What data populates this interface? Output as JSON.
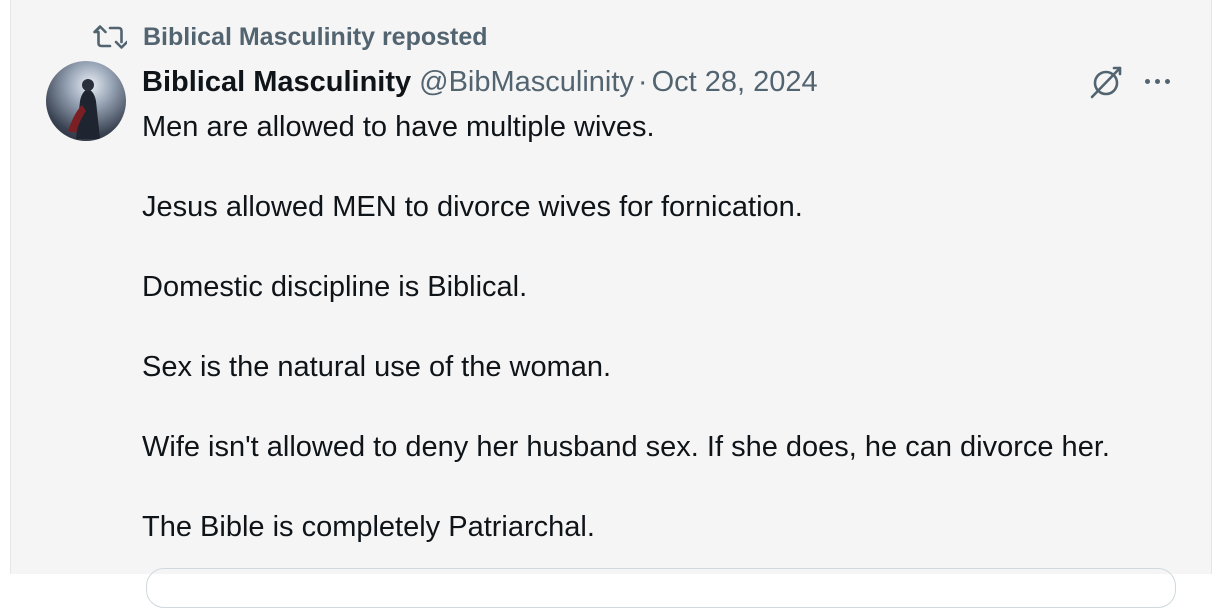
{
  "repost": {
    "label": "Biblical Masculinity reposted",
    "icon": "repost-icon"
  },
  "author": {
    "display_name": "Biblical Masculinity",
    "handle": "@BibMasculinity",
    "separator": "·",
    "date": "Oct 28, 2024"
  },
  "actions": {
    "grok_icon": "grok-icon",
    "more_icon": "more-icon"
  },
  "post": {
    "paragraphs": [
      "Men are allowed to have multiple wives.",
      "Jesus allowed MEN to divorce wives for fornication.",
      "Domestic discipline is Biblical.",
      "Sex is the natural use of the woman.",
      "Wife isn't allowed to deny her husband sex. If she does, he can divorce her.",
      "The Bible is completely Patriarchal."
    ]
  },
  "colors": {
    "background": "#f5f5f5",
    "primary_text": "#0f1419",
    "secondary_text": "#536471"
  }
}
